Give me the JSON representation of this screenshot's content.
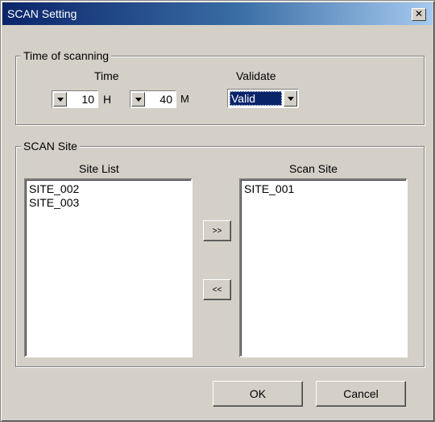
{
  "window": {
    "title": "SCAN Setting",
    "close_glyph": "✕"
  },
  "time_group": {
    "label": "Time of scanning",
    "time_label": "Time",
    "hour_value": "10",
    "hour_unit": "H",
    "minute_value": "40",
    "minute_unit": "M",
    "validate_label": "Validate",
    "validate_selected": "Valid"
  },
  "site_group": {
    "label": "SCAN Site",
    "site_list_label": "Site List",
    "site_list_items": [
      "SITE_002",
      "SITE_003"
    ],
    "scan_site_label": "Scan Site",
    "scan_site_items": [
      "SITE_001"
    ],
    "add_label": ">>",
    "remove_label": "<<"
  },
  "buttons": {
    "ok": "OK",
    "cancel": "Cancel"
  }
}
